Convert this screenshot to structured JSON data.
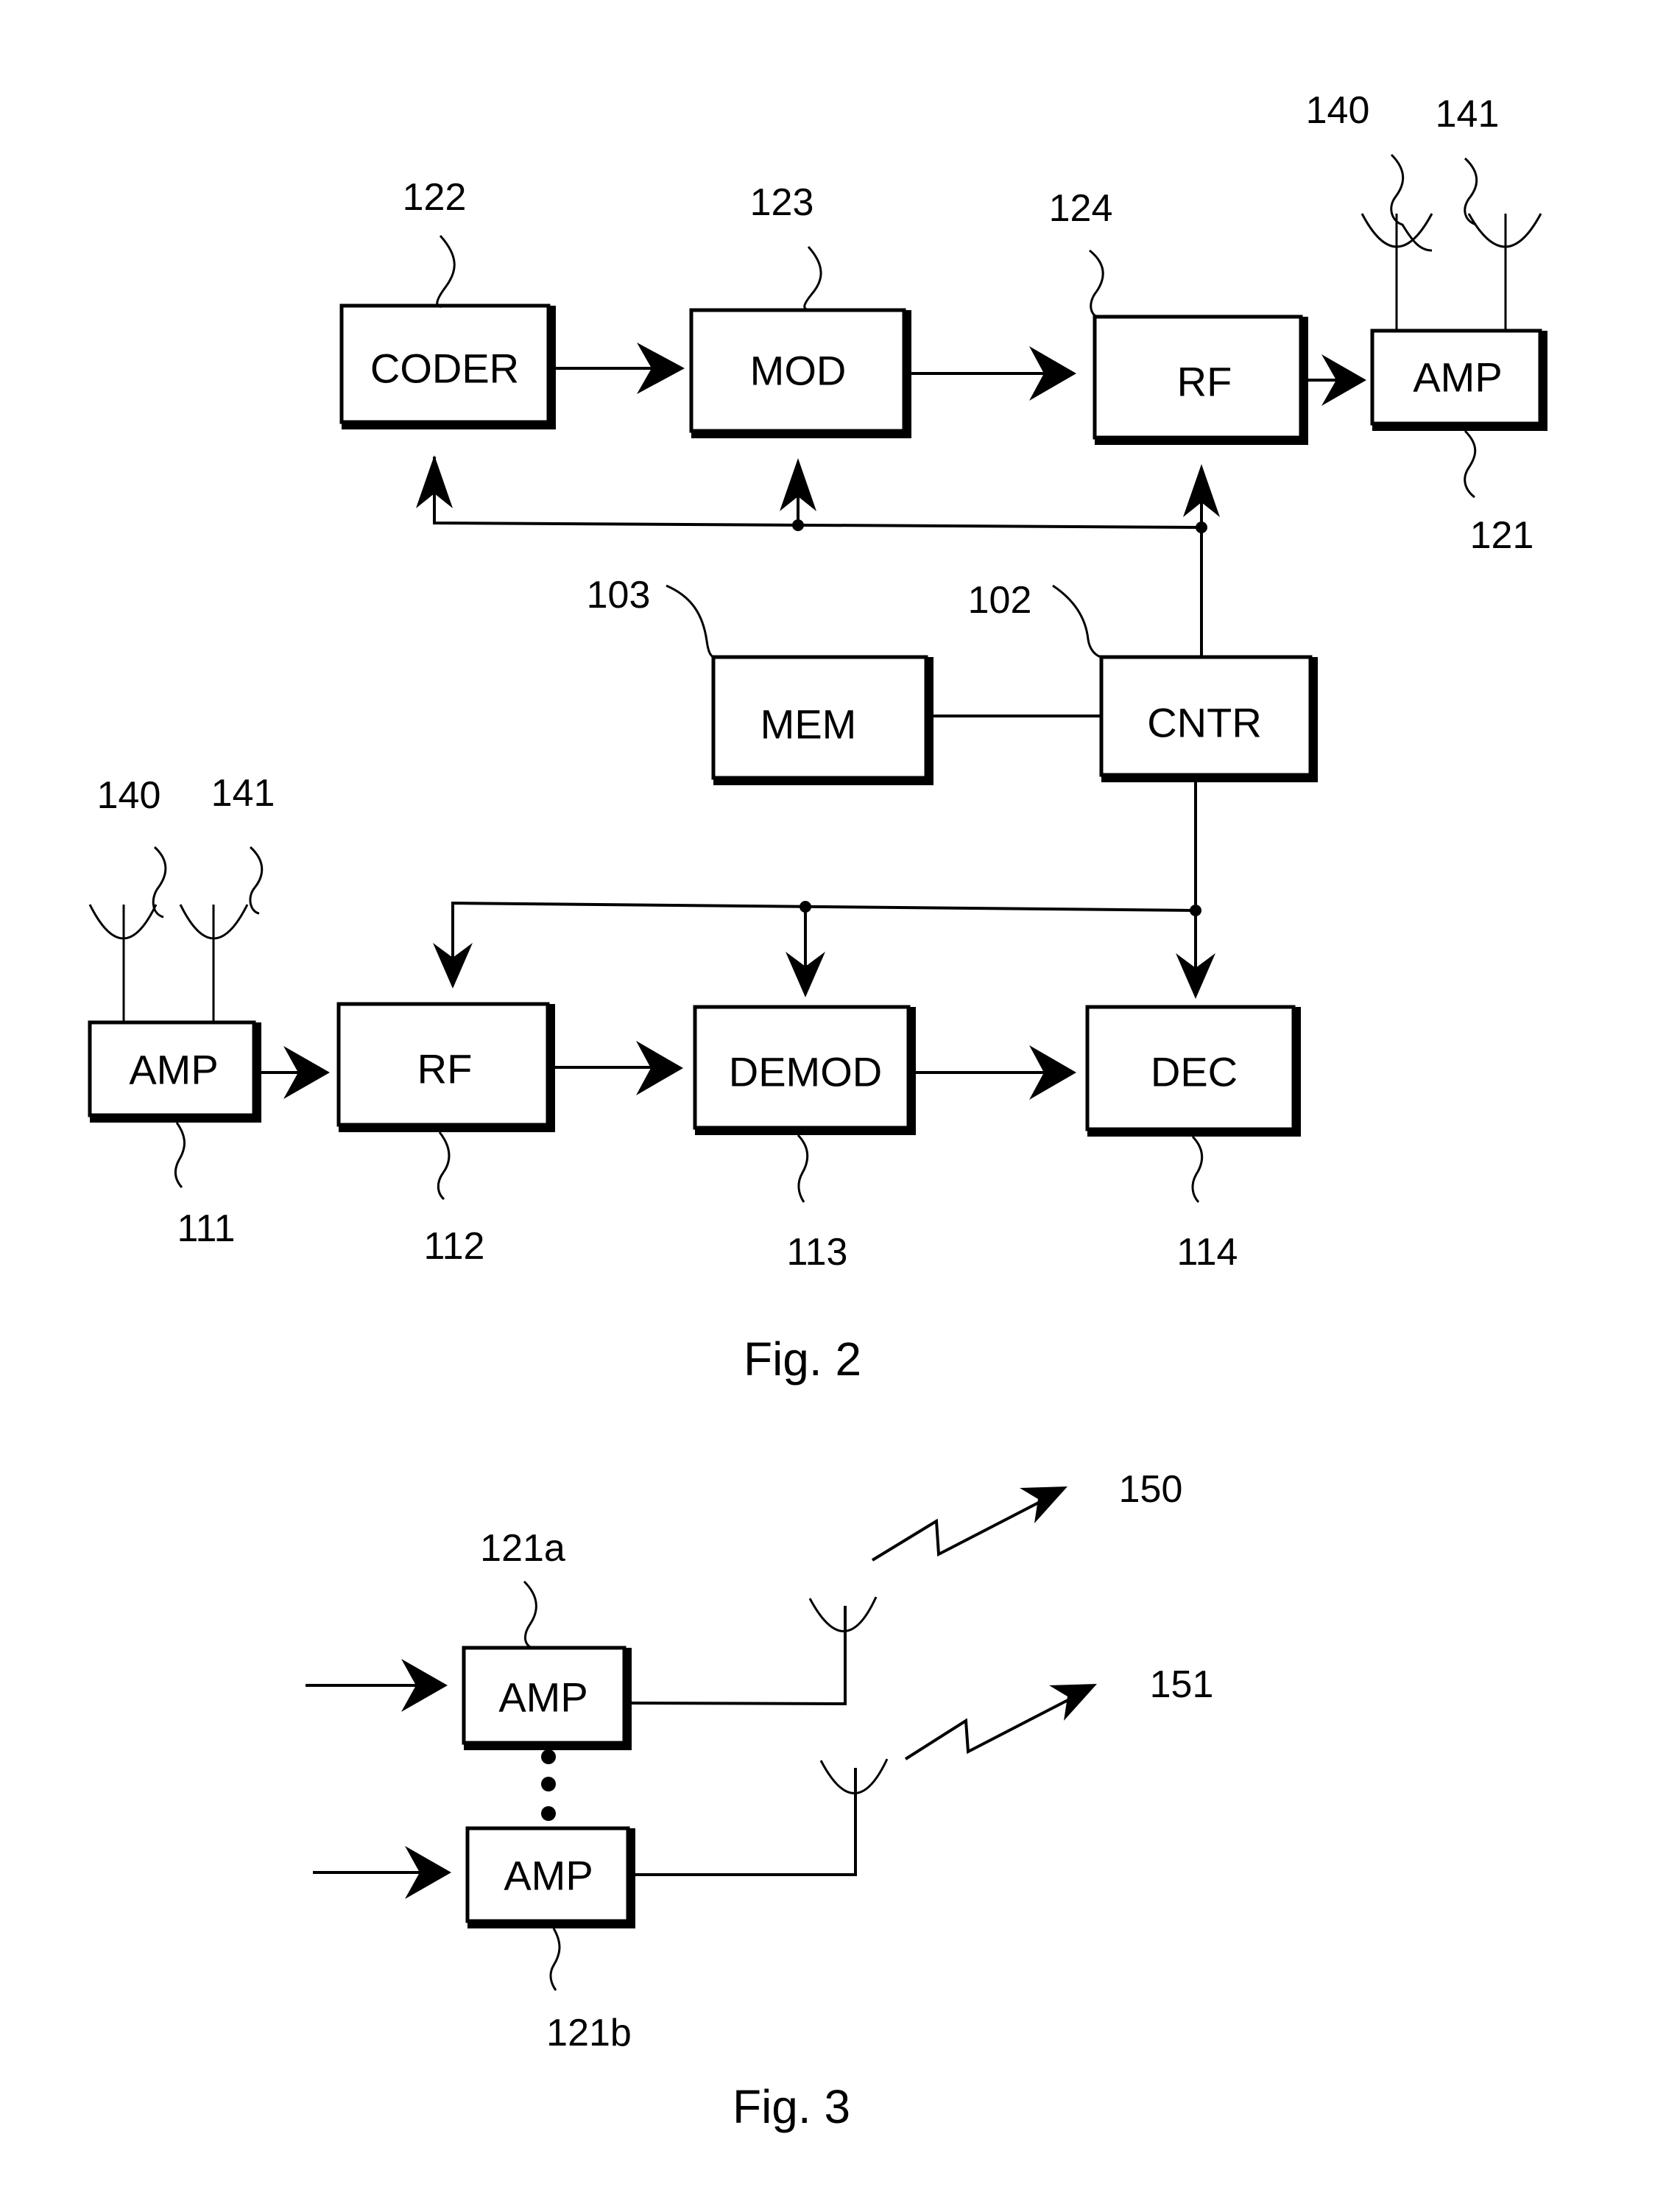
{
  "figures": [
    {
      "id": "fig2",
      "caption": "Fig. 2",
      "blocks": [
        {
          "id": "coder",
          "label": "CODER",
          "ref": "122"
        },
        {
          "id": "mod",
          "label": "MOD",
          "ref": "123"
        },
        {
          "id": "rf_tx",
          "label": "RF",
          "ref": "124"
        },
        {
          "id": "amp_tx",
          "label": "AMP",
          "ref": "121"
        },
        {
          "id": "mem",
          "label": "MEM",
          "ref": "103"
        },
        {
          "id": "cntr",
          "label": "CNTR",
          "ref": "102"
        },
        {
          "id": "amp_rx",
          "label": "AMP",
          "ref": "111"
        },
        {
          "id": "rf_rx",
          "label": "RF",
          "ref": "112"
        },
        {
          "id": "demod",
          "label": "DEMOD",
          "ref": "113"
        },
        {
          "id": "dec",
          "label": "DEC",
          "ref": "114"
        }
      ],
      "antennas": [
        {
          "id": "ant_tx_a",
          "ref": "140",
          "attached_to": "amp_tx"
        },
        {
          "id": "ant_tx_b",
          "ref": "141",
          "attached_to": "amp_tx"
        },
        {
          "id": "ant_rx_a",
          "ref": "140",
          "attached_to": "amp_rx"
        },
        {
          "id": "ant_rx_b",
          "ref": "141",
          "attached_to": "amp_rx"
        }
      ],
      "connections": [
        {
          "from": "coder",
          "to": "mod",
          "arrow": true
        },
        {
          "from": "mod",
          "to": "rf_tx",
          "arrow": true
        },
        {
          "from": "rf_tx",
          "to": "amp_tx",
          "arrow": true
        },
        {
          "from": "cntr",
          "to": "coder",
          "arrow": true
        },
        {
          "from": "cntr",
          "to": "mod",
          "arrow": true
        },
        {
          "from": "cntr",
          "to": "rf_tx",
          "arrow": true
        },
        {
          "from": "mem",
          "to": "cntr",
          "arrow": false
        },
        {
          "from": "cntr",
          "to": "rf_rx",
          "arrow": true
        },
        {
          "from": "cntr",
          "to": "demod",
          "arrow": true
        },
        {
          "from": "cntr",
          "to": "dec",
          "arrow": true
        },
        {
          "from": "amp_rx",
          "to": "rf_rx",
          "arrow": true
        },
        {
          "from": "rf_rx",
          "to": "demod",
          "arrow": true
        },
        {
          "from": "demod",
          "to": "dec",
          "arrow": true
        }
      ]
    },
    {
      "id": "fig3",
      "caption": "Fig. 3",
      "blocks": [
        {
          "id": "amp_a",
          "label": "AMP",
          "ref": "121a"
        },
        {
          "id": "amp_b",
          "label": "AMP",
          "ref": "121b"
        }
      ],
      "ellipsis": "vertical-dots",
      "beams": [
        {
          "id": "beam_a",
          "ref": "150",
          "from": "amp_a"
        },
        {
          "id": "beam_b",
          "ref": "151",
          "from": "amp_b"
        }
      ]
    }
  ],
  "icons": {
    "antenna": "antenna-icon",
    "signal": "lightning-arrow-icon",
    "arrow": "arrowhead-icon",
    "junction": "junction-dot-icon"
  }
}
